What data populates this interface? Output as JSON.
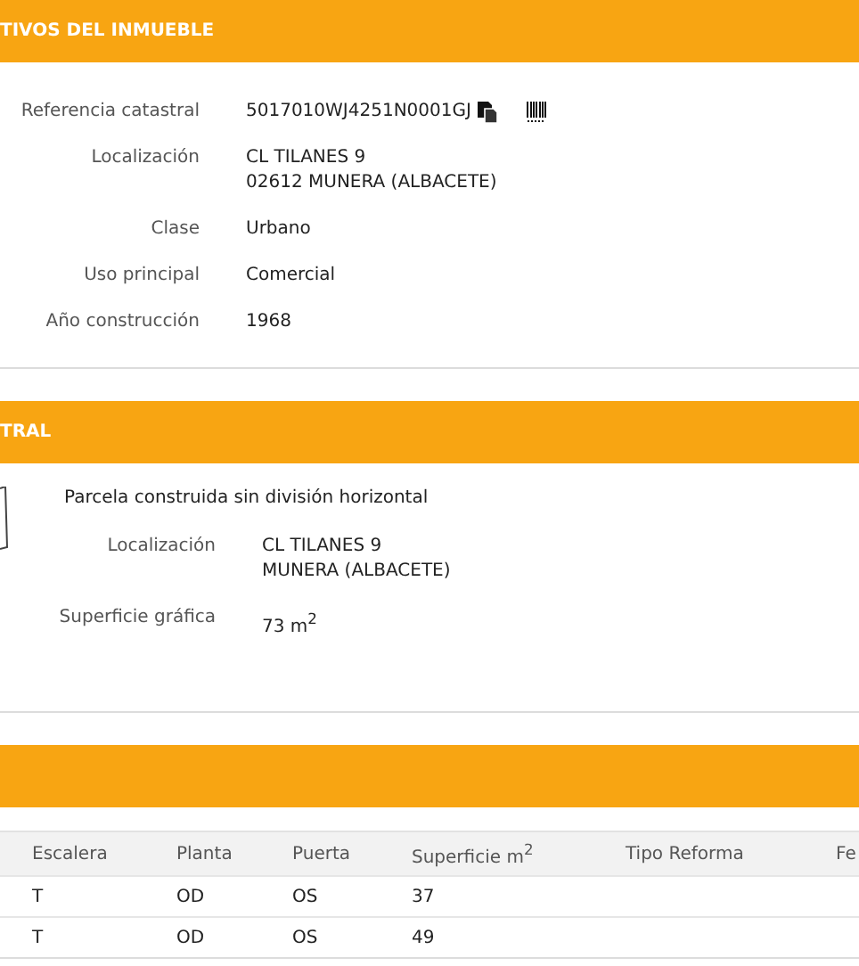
{
  "property_section": {
    "title": "TIVOS DEL INMUEBLE",
    "fields": [
      {
        "label": "Referencia catastral",
        "lines": [
          "5017010WJ4251N0001GJ"
        ],
        "kind": "reference"
      },
      {
        "label": "Localización",
        "lines": [
          "CL TILANES 9",
          "02612 MUNERA (ALBACETE)"
        ],
        "kind": "text"
      },
      {
        "label": "Clase",
        "lines": [
          "Urbano"
        ],
        "kind": "text"
      },
      {
        "label": "Uso principal",
        "lines": [
          "Comercial"
        ],
        "kind": "text"
      },
      {
        "label": "Año construcción",
        "lines": [
          "1968"
        ],
        "kind": "text"
      }
    ]
  },
  "parcel_section": {
    "title": "TRAL",
    "description": "Parcela construida sin división horizontal",
    "fields": [
      {
        "label": "Localización",
        "lines": [
          "CL TILANES 9",
          "MUNERA (ALBACETE)"
        ]
      },
      {
        "label": "Superficie gráfica",
        "lines": [
          "73 m$^{2}$"
        ]
      }
    ]
  },
  "construction_section": {
    "table": {
      "columns": [
        "Escalera",
        "Planta",
        "Puerta",
        "Superficie m$^{2}$",
        "Tipo Reforma",
        "Fe"
      ],
      "rows": [
        [
          "T",
          "OD",
          "OS",
          "37",
          "",
          ""
        ],
        [
          "T",
          "OD",
          "OS",
          "49",
          "",
          ""
        ]
      ]
    }
  }
}
